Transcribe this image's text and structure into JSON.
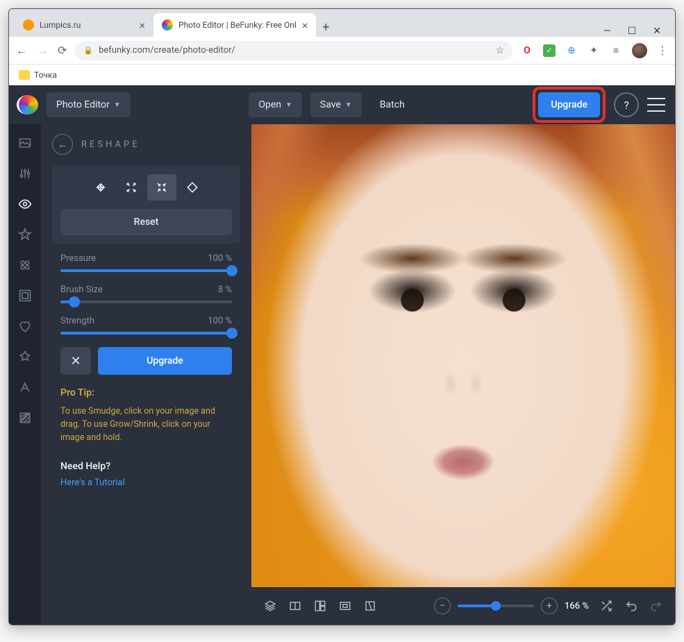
{
  "tabs": [
    {
      "title": "Lumpics.ru"
    },
    {
      "title": "Photo Editor | BeFunky: Free Onl"
    }
  ],
  "url": "befunky.com/create/photo-editor/",
  "bookmark": {
    "label": "Точка"
  },
  "header": {
    "product": "Photo Editor",
    "open": "Open",
    "save": "Save",
    "batch": "Batch",
    "upgrade": "Upgrade"
  },
  "panel": {
    "title": "RESHAPE",
    "reset": "Reset",
    "sliders": {
      "pressure": {
        "label": "Pressure",
        "value": "100 %",
        "pct": 100
      },
      "brush": {
        "label": "Brush Size",
        "value": "8 %",
        "pct": 8
      },
      "strength": {
        "label": "Strength",
        "value": "100 %",
        "pct": 100
      }
    },
    "upgrade": "Upgrade",
    "tip_title": "Pro Tip:",
    "tip_text": "To use Smudge, click on your image and drag. To use Grow/Shrink, click on your image and hold.",
    "help_title": "Need Help?",
    "help_link": "Here's a Tutorial"
  },
  "bottombar": {
    "zoom": "166 %"
  }
}
